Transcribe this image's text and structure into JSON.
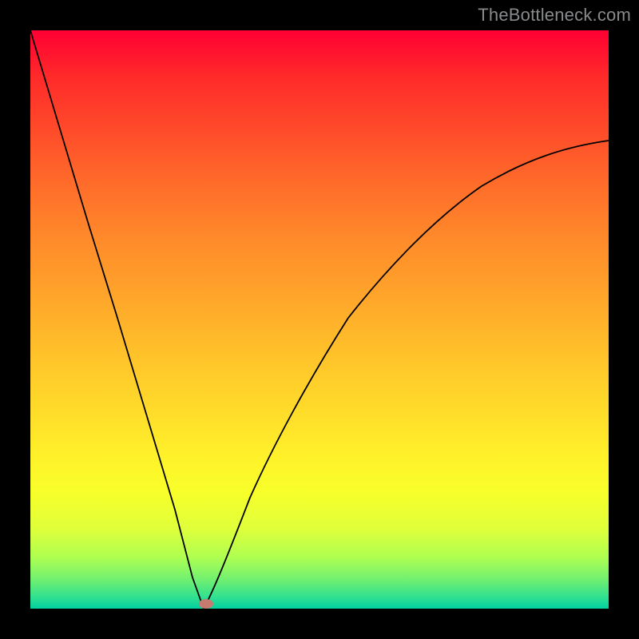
{
  "watermark": "TheBottleneck.com",
  "chart_data": {
    "type": "line",
    "title": "",
    "xlabel": "",
    "ylabel": "",
    "x": [
      0.0,
      0.05,
      0.1,
      0.15,
      0.2,
      0.25,
      0.28,
      0.3,
      0.34,
      0.38,
      0.42,
      0.48,
      0.55,
      0.62,
      0.7,
      0.78,
      0.86,
      0.93,
      1.0
    ],
    "values": [
      1.0,
      0.83,
      0.67,
      0.5,
      0.33,
      0.16,
      0.05,
      0.0,
      0.08,
      0.19,
      0.3,
      0.42,
      0.53,
      0.61,
      0.68,
      0.73,
      0.77,
      0.79,
      0.81
    ],
    "xlim": [
      0,
      1
    ],
    "ylim": [
      0,
      1
    ],
    "minimum_marker": {
      "x": 0.3,
      "y": 0.0
    },
    "background_gradient": [
      "#ff0033",
      "#ff2a2a",
      "#ff6a2a",
      "#ffa52a",
      "#ffdc2a",
      "#fff22a",
      "#b0ff50",
      "#30e090",
      "#00d0a0"
    ]
  }
}
